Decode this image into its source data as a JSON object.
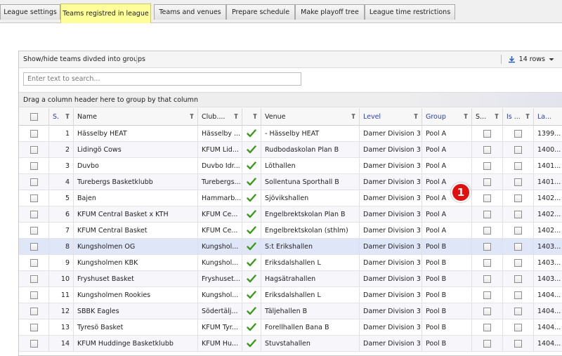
{
  "tabs": [
    {
      "label": "League settings",
      "active": false
    },
    {
      "label": "Teams registred in league",
      "active": true
    },
    {
      "label": "Teams and venues",
      "active": false
    },
    {
      "label": "Prepare schedule",
      "active": false
    },
    {
      "label": "Make playoff tree",
      "active": false
    },
    {
      "label": "League time restrictions",
      "active": false
    }
  ],
  "toolbar": {
    "toggle_groups_label": "Show/hide teams divded into groups",
    "rows_label": "14 rows",
    "download_icon": "download-icon",
    "dropdown_icon": "chevron-down-icon"
  },
  "search": {
    "placeholder": "Enter text to search..."
  },
  "groupbar": {
    "hint": "Drag a column header here to group by that column"
  },
  "columns": {
    "seq": "S.",
    "name": "Name",
    "club": "Club....",
    "check": "",
    "venue": "Venue",
    "level": "Level",
    "group": "Group",
    "s": "S...",
    "is": "Is ...",
    "la": "La..."
  },
  "rows": [
    {
      "seq": "1",
      "name": "Hässelby HEAT",
      "club": "Hässelby ...",
      "venue": "- Hässelby HEAT",
      "level": "Damer Division 3",
      "group": "Pool A",
      "la": "1399..."
    },
    {
      "seq": "2",
      "name": "Lidingö Cows",
      "club": "KFUM Lid...",
      "venue": "Rudbodaskolan Plan B",
      "level": "Damer Division 3",
      "group": "Pool A",
      "la": "1400..."
    },
    {
      "seq": "3",
      "name": "Duvbo",
      "club": "Duvbo Idr...",
      "venue": "Löthallen",
      "level": "Damer Division 3",
      "group": "Pool A",
      "la": "1401..."
    },
    {
      "seq": "4",
      "name": "Turebergs Basketklubb",
      "club": "Turebergs...",
      "venue": "Sollentuna Sporthall B",
      "level": "Damer Division 3",
      "group": "Pool A",
      "la": "1401..."
    },
    {
      "seq": "5",
      "name": "Bajen",
      "club": "Hammarb...",
      "venue": "Sjövikshallen",
      "level": "Damer Division 3",
      "group": "Pool A",
      "la": "1402..."
    },
    {
      "seq": "6",
      "name": "KFUM Central Basket x KTH",
      "club": "KFUM Ce...",
      "venue": "Engelbrektskolan Plan B",
      "level": "Damer Division 3",
      "group": "Pool A",
      "la": "1402..."
    },
    {
      "seq": "7",
      "name": "KFUM Central Basket",
      "club": "KFUM Ce...",
      "venue": "Engelbrektskolan (sthlm)",
      "level": "Damer Division 3",
      "group": "Pool A",
      "la": "1402..."
    },
    {
      "seq": "8",
      "name": "Kungsholmen OG",
      "club": "Kungshol...",
      "venue": "S:t Erikshallen",
      "level": "Damer Division 3",
      "group": "Pool B",
      "la": "1403..."
    },
    {
      "seq": "9",
      "name": "Kungsholmen KBK",
      "club": "Kungshol...",
      "venue": "Eriksdalshallen L",
      "level": "Damer Division 3",
      "group": "Pool B",
      "la": "1403..."
    },
    {
      "seq": "10",
      "name": "Fryshuset Basket",
      "club": "Fryshuset...",
      "venue": "Hagsätrahallen",
      "level": "Damer Division 3",
      "group": "Pool B",
      "la": "1403..."
    },
    {
      "seq": "11",
      "name": "Kungsholmen Rookies",
      "club": "Kungshol...",
      "venue": "Eriksdalshallen L",
      "level": "Damer Division 3",
      "group": "Pool B",
      "la": "1404..."
    },
    {
      "seq": "12",
      "name": "SBBK Eagles",
      "club": "Södertälj...",
      "venue": "Täljehallen B",
      "level": "Damer Division 3",
      "group": "Pool B",
      "la": "1404..."
    },
    {
      "seq": "13",
      "name": "Tyresö Basket",
      "club": "KFUM Tyr...",
      "venue": "Forellhallen Bana B",
      "level": "Damer Division 3",
      "group": "Pool B",
      "la": "1404..."
    },
    {
      "seq": "14",
      "name": "KFUM Huddinge Basketklubb",
      "club": "KFUM Hu...",
      "venue": "Stuvstahallen",
      "level": "Damer Division 3",
      "group": "Pool B",
      "la": "1404..."
    }
  ],
  "selected_row": 8,
  "badge": {
    "label": "1"
  },
  "colors": {
    "active_tab": "#fdfd9a",
    "selected_row": "#dfe6f7",
    "badge": "#e01010",
    "check": "#3a9a1a",
    "blue_header": "#2a3fb0"
  }
}
